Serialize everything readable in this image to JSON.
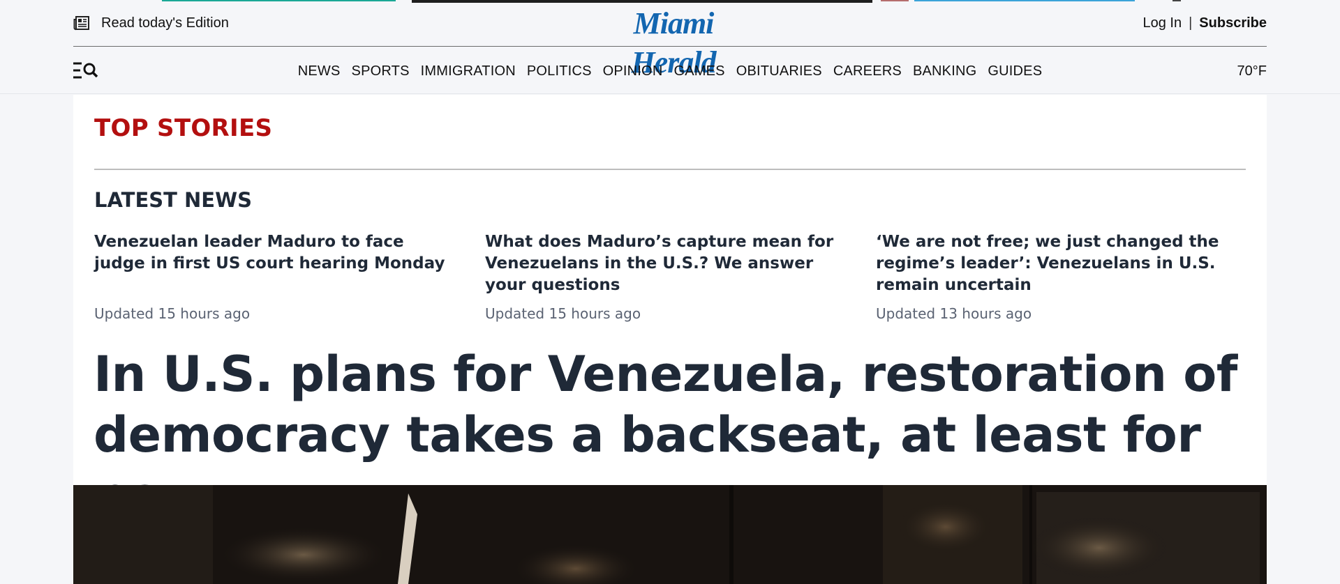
{
  "masthead": {
    "edition_label": "Read today's Edition",
    "logo_text": "Miami Herald",
    "login_label": "Log In",
    "separator": "|",
    "subscribe_label": "Subscribe"
  },
  "nav": {
    "items": [
      "NEWS",
      "SPORTS",
      "IMMIGRATION",
      "POLITICS",
      "OPINION",
      "GAMES",
      "OBITUARIES",
      "CAREERS",
      "BANKING",
      "GUIDES"
    ],
    "weather": "70°F"
  },
  "main": {
    "section_title": "TOP STORIES",
    "latest_title": "LATEST NEWS",
    "stories": [
      {
        "headline": "Venezuelan leader Maduro to face judge in first US court hearing Monday",
        "time": "Updated 15 hours ago"
      },
      {
        "headline": "What does Maduro’s capture mean for Venezuelans in the U.S.? We answer your questions",
        "time": "Updated 15 hours ago"
      },
      {
        "headline": "‘We are not free; we just changed the regime’s leader’: Venezuelans in U.S. remain uncertain",
        "time": "Updated 13 hours ago"
      }
    ],
    "lead_headline": "In U.S. plans for Venezuela, restoration of democracy takes a backseat, at least for now"
  },
  "colors": {
    "brand_blue": "#1366b0",
    "section_red": "#b30f0f",
    "text_dark": "#1f2937",
    "meta_gray": "#5a6272"
  }
}
